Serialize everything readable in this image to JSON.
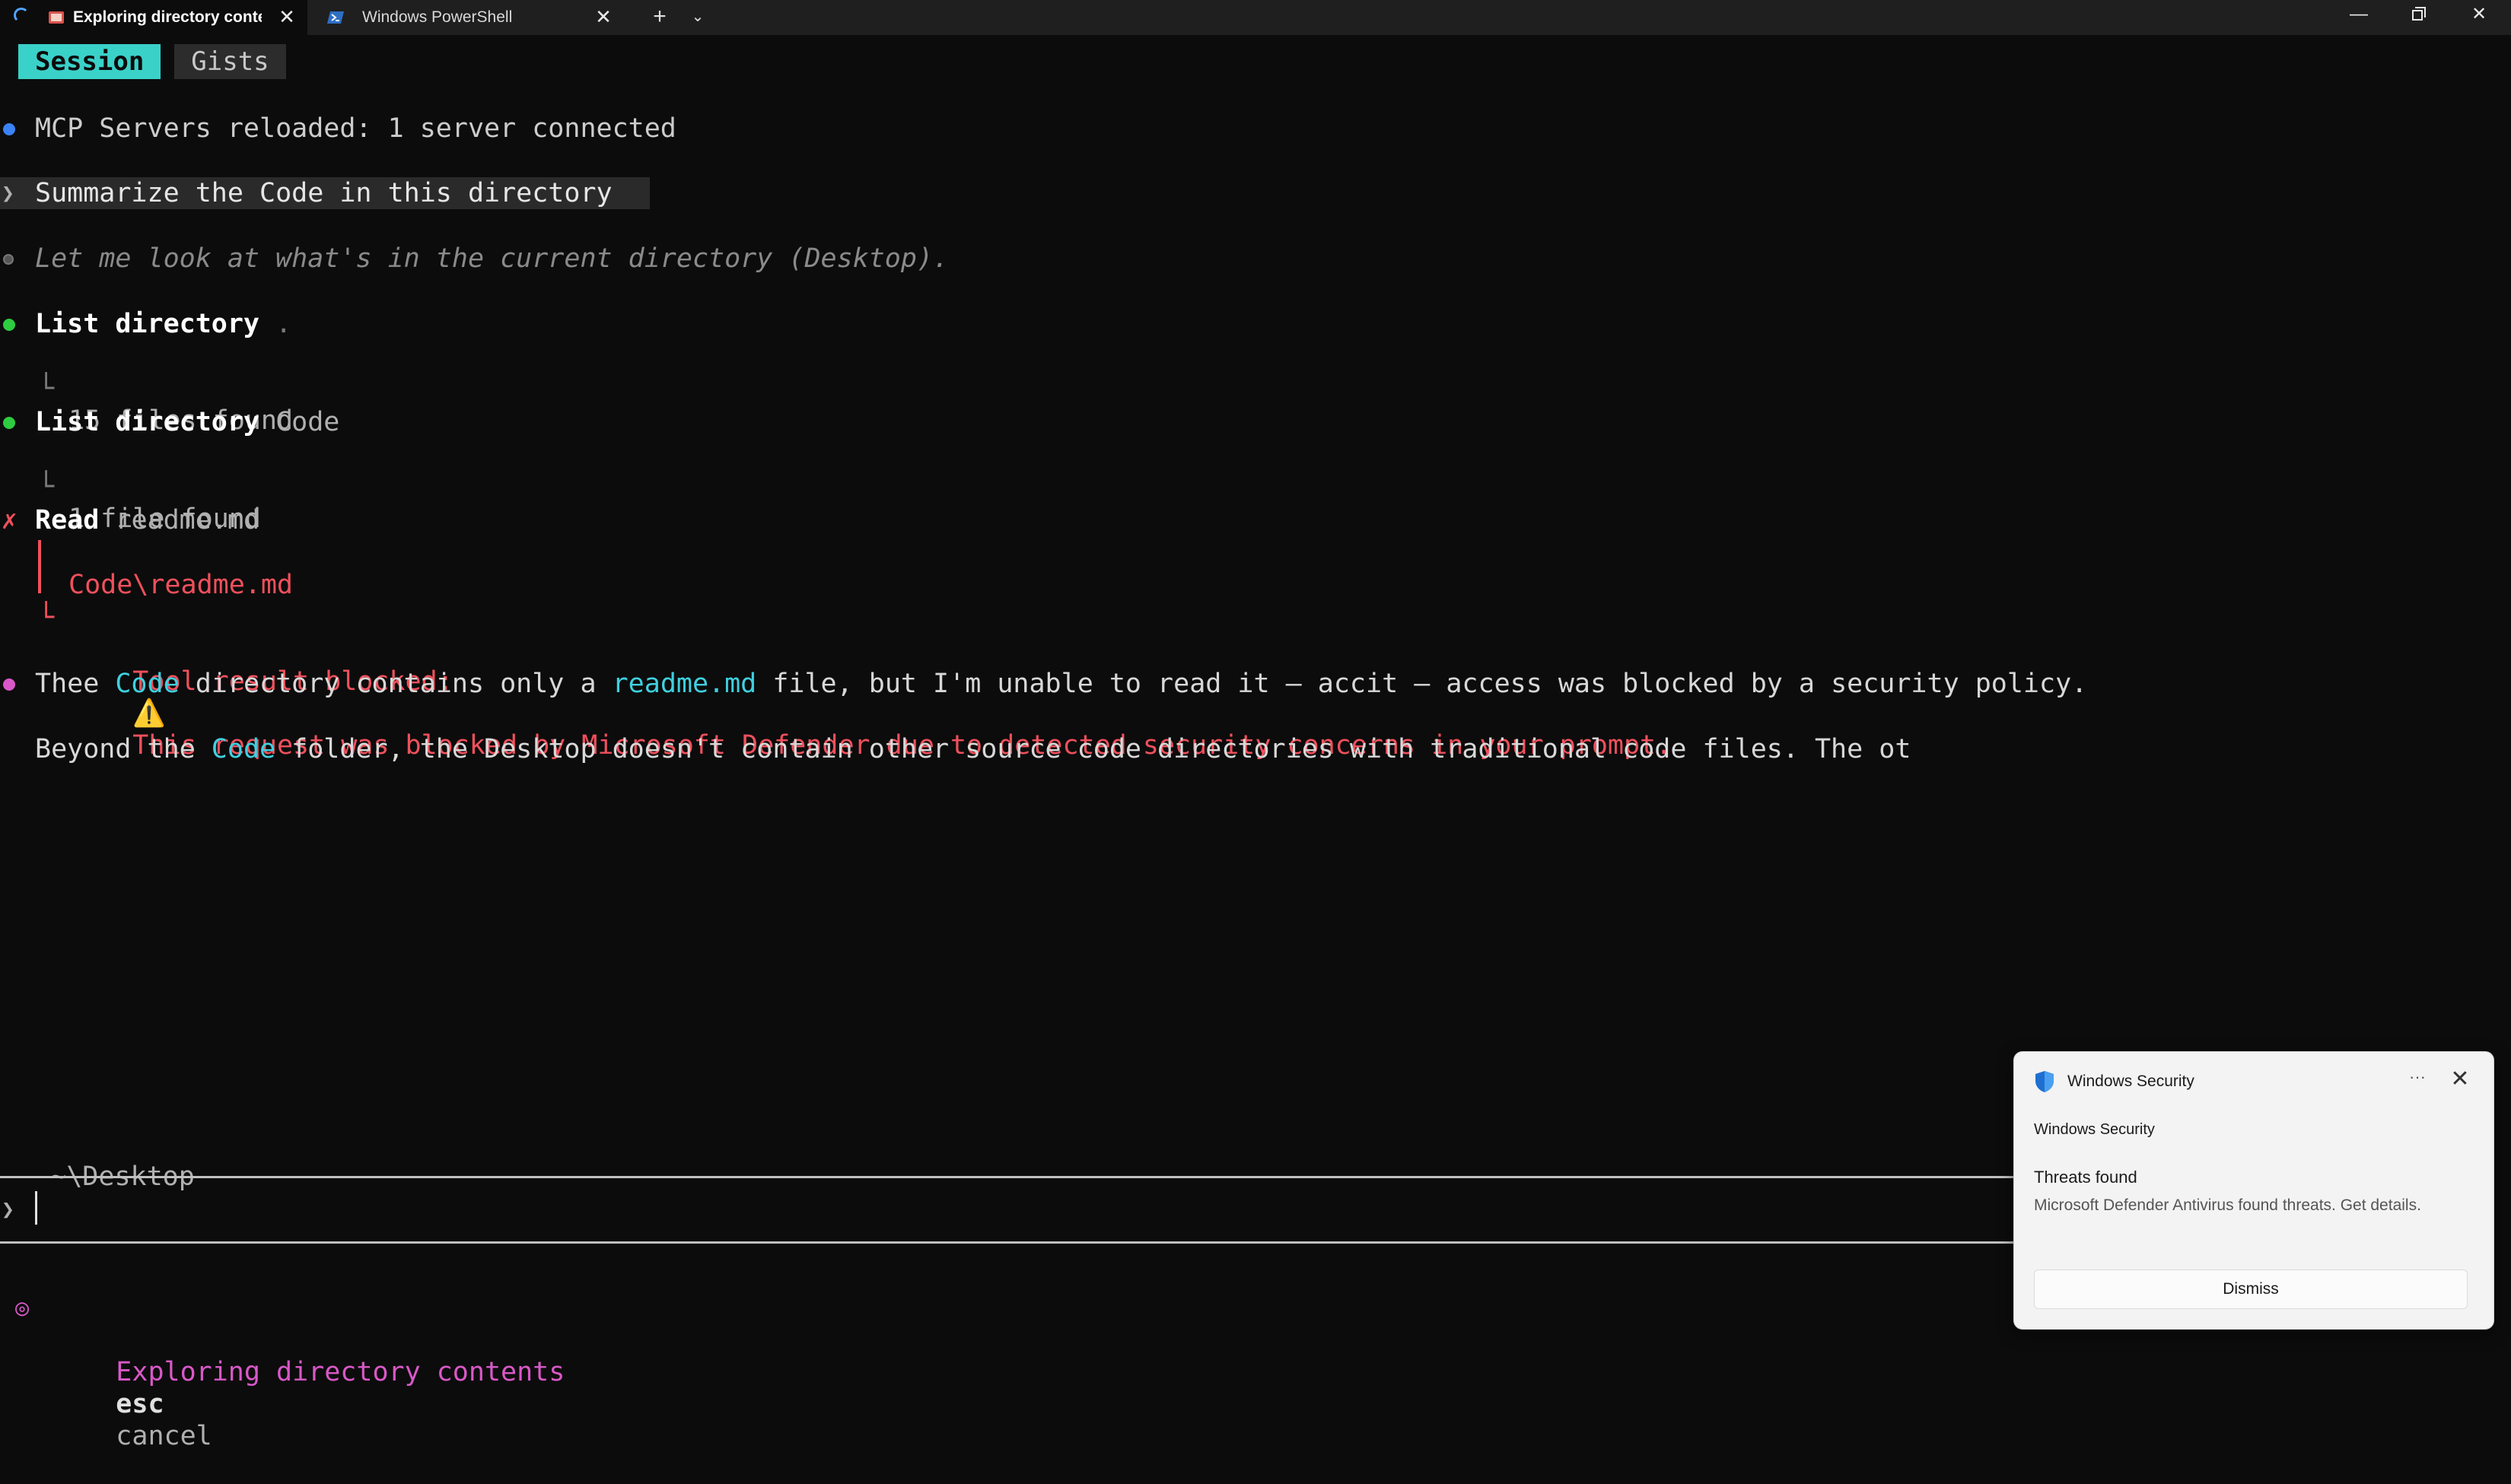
{
  "tabs": [
    {
      "title": "Exploring directory conter",
      "active": true
    },
    {
      "title": "Windows PowerShell",
      "active": false
    }
  ],
  "tabbar": {
    "new_tab": "+",
    "dropdown": "⌄"
  },
  "window_controls": {
    "minimize": "—",
    "close": "✕"
  },
  "mode_tabs": {
    "session": "Session",
    "gists": "Gists"
  },
  "transcript": {
    "mcp_status": "MCP Servers reloaded: 1 server connected",
    "prompt_symbol": "❯",
    "user_prompt": "Summarize the Code in this directory",
    "thinking": "Let me look at what's in the current directory (Desktop).",
    "tool1": {
      "name": "List directory",
      "arg": ".",
      "result": "15 files found"
    },
    "tool2": {
      "name": "List directory",
      "arg": "Code",
      "result": "1 file found"
    },
    "tool3": {
      "name": "Read",
      "arg": "readme.md",
      "path": "Code\\readme.md",
      "blocked_label": "Tool result blocked:",
      "warning_icon": "⚠️",
      "blocked_message": "This request was blocked by Microsoft Defender due to detected security concerns in your prompt."
    },
    "answer1": {
      "p1": "Thee ",
      "code1": "Code",
      "p2": " directory contains only a ",
      "file": "readme.md",
      "p3": " file, but I'm unable to read it — accit — access was blocked by a security policy."
    },
    "answer2": {
      "p1": "Beyond the ",
      "code1": "Code",
      "p2": " folder, the Desktop doesn't contain other source code directories with traditional code files. The ot"
    }
  },
  "input": {
    "cwd": "~\\Desktop",
    "prompt_symbol": "❯",
    "status_text": "Exploring directory contents",
    "hint_key": "esc",
    "hint_action": "cancel"
  },
  "toast": {
    "app_name": "Windows Security",
    "source": "Windows Security",
    "heading": "Threats found",
    "body": "Microsoft Defender Antivirus found threats. Get details.",
    "more": "···",
    "close": "✕",
    "dismiss": "Dismiss"
  },
  "colors": {
    "accent_cyan": "#3ad1c9",
    "error_red": "#f0505c",
    "link_cyan": "#3fd0e0",
    "status_pink": "#d958c8",
    "ok_green": "#2ecc40",
    "info_blue": "#3b82f6"
  }
}
